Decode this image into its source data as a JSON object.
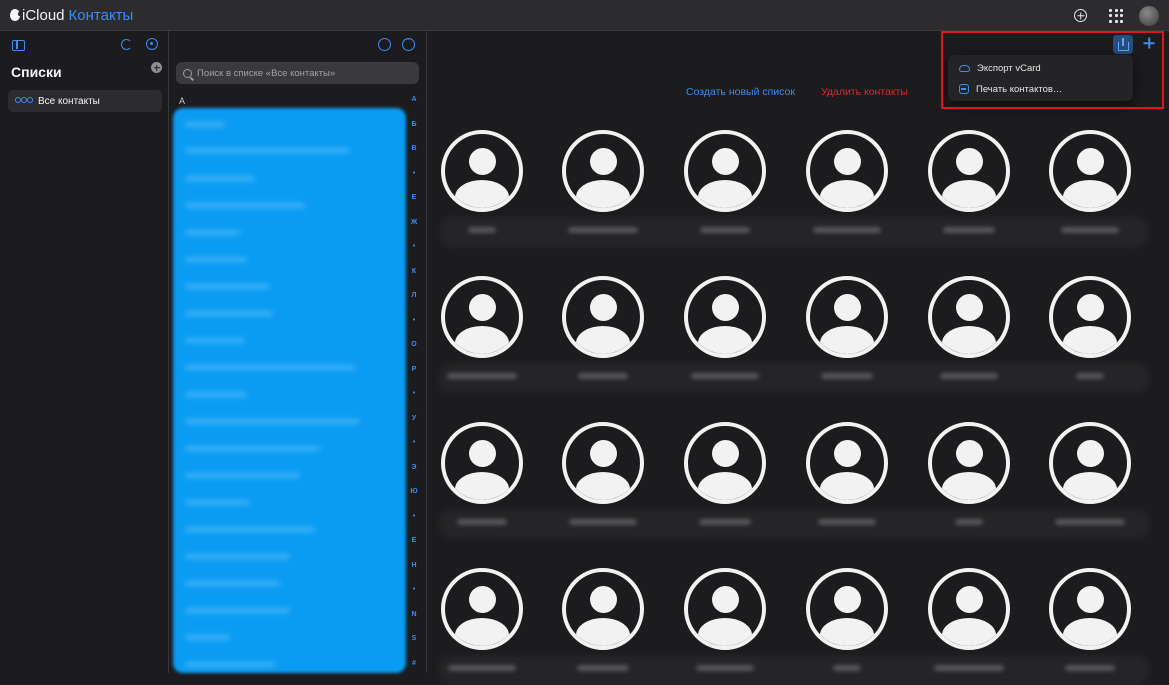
{
  "app": {
    "brand": "iCloud",
    "app_name": "Контакты"
  },
  "topbar": {
    "add_icon": "plus-circle-icon",
    "apps_icon": "grid-icon",
    "avatar": "account-avatar"
  },
  "sidebar": {
    "title": "Списки",
    "items": [
      {
        "label": "Все контакты",
        "icon": "people-icon"
      }
    ]
  },
  "contact_list": {
    "search_placeholder": "Поиск в списке «Все контакты»",
    "section_header": "А",
    "alpha_index": [
      "А",
      "Б",
      "В",
      "•",
      "Е",
      "Ж",
      "•",
      "К",
      "Л",
      "•",
      "О",
      "Р",
      "•",
      "У",
      "•",
      "Э",
      "Ю",
      "•",
      "E",
      "H",
      "•",
      "N",
      "S",
      "#"
    ]
  },
  "main": {
    "create_list_link": "Создать новый список",
    "delete_contacts_link": "Удалить контакты",
    "share_menu": {
      "items": [
        {
          "label": "Экспорт vCard",
          "icon": "cloud-download-icon"
        },
        {
          "label": "Печать контактов…",
          "icon": "printer-icon"
        }
      ]
    },
    "highlight_color": "#e0141e",
    "accent_color": "#3b8cf3"
  }
}
